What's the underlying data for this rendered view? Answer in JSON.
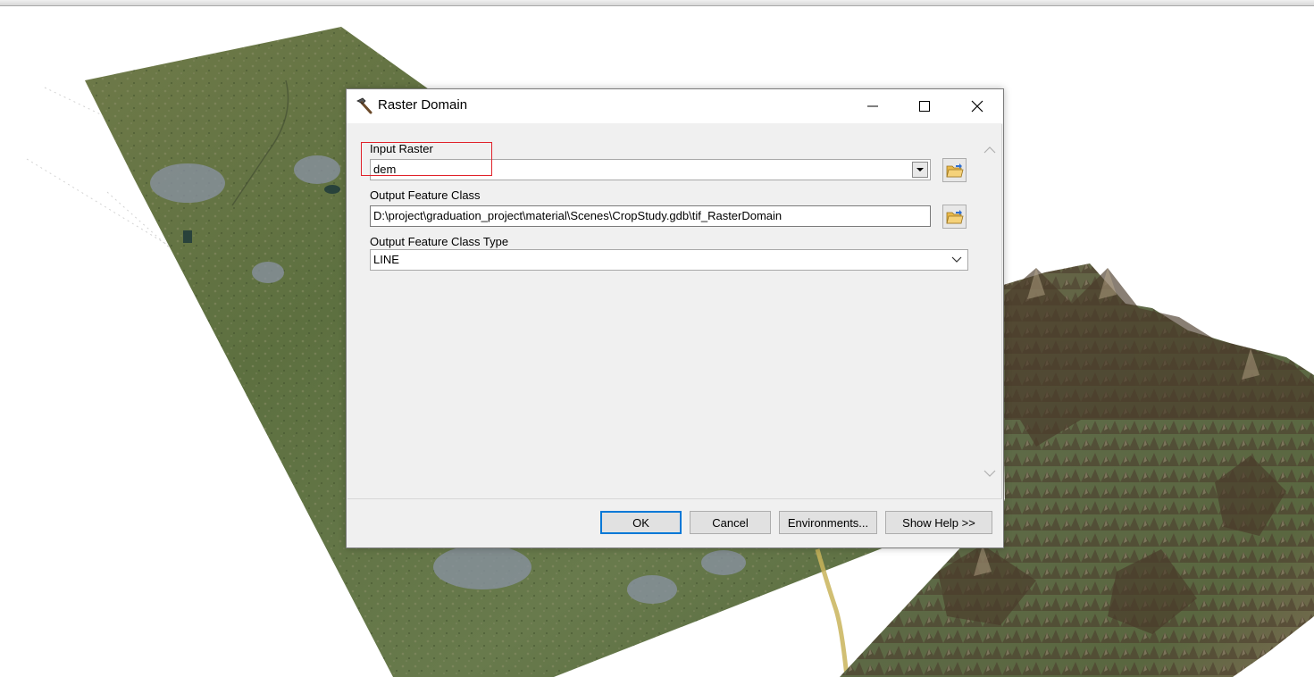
{
  "dialog": {
    "title": "Raster Domain",
    "icon": "hammer-icon",
    "window_buttons": [
      "minimize-icon",
      "maximize-icon",
      "close-icon"
    ]
  },
  "params": {
    "input_raster_label": "Input Raster",
    "input_raster_value": "dem",
    "output_class_label": "Output Feature Class",
    "output_class_value": "D:\\project\\graduation_project\\material\\Scenes\\CropStudy.gdb\\tif_RasterDomain",
    "output_type_label": "Output Feature Class Type",
    "output_type_value": "LINE"
  },
  "buttons": {
    "ok": "OK",
    "cancel": "Cancel",
    "environments": "Environments...",
    "help": "Show Help >>"
  },
  "colors": {
    "highlight": "#e0222a",
    "accent": "#0078d7"
  }
}
